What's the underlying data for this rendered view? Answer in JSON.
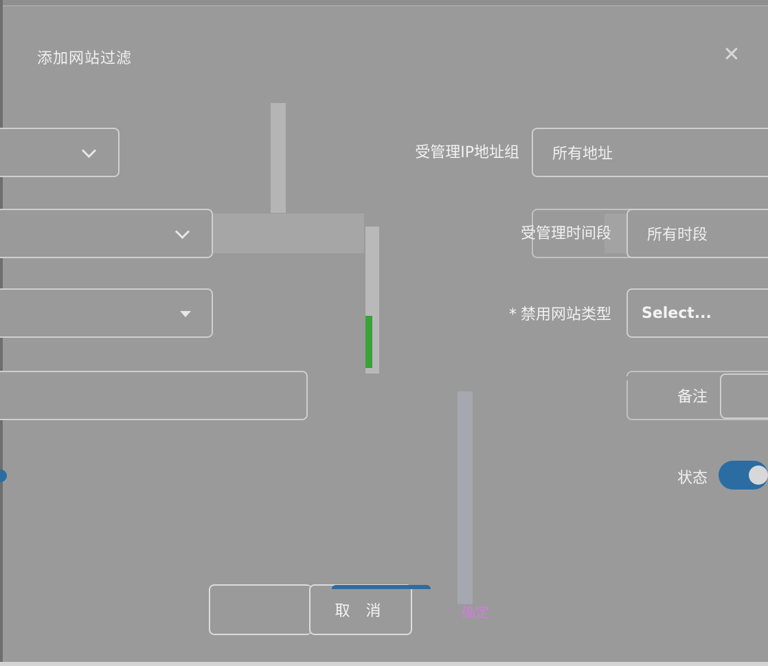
{
  "dialog": {
    "title": "添加网站过滤",
    "close_icon": "close-icon"
  },
  "form": {
    "managed_ip_label": "受管理IP地址组",
    "managed_ip_value": "所有地址",
    "managed_time_label": "受管理时间段",
    "managed_time_value": "所有时段",
    "blocked_type_label": "禁用网站类型",
    "blocked_type_required": "*",
    "blocked_type_placeholder": "Select...",
    "remark_label": "备注",
    "status_label": "状态",
    "status_on": true
  },
  "footer": {
    "cancel_label": "取 消",
    "ok_label": "确定"
  },
  "colors": {
    "accent": "#2b6ca3",
    "background": "#9a9a9a"
  }
}
